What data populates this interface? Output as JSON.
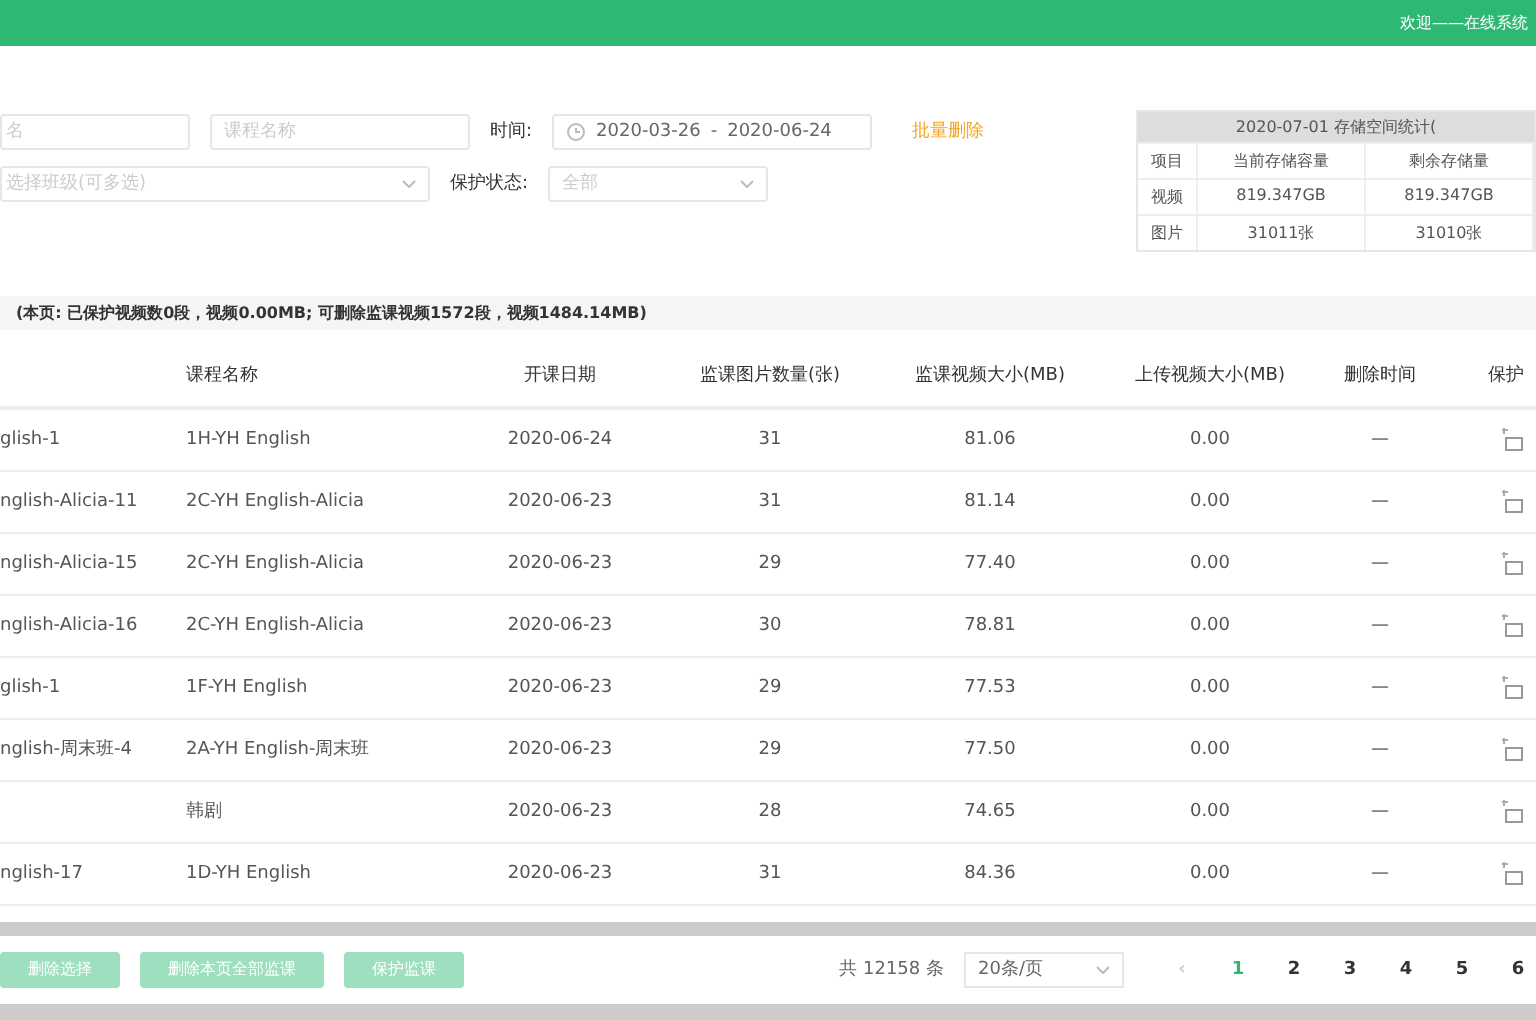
{
  "header": {
    "user_text": "欢迎——在线系统"
  },
  "filters": {
    "name_placeholder": "名",
    "course_placeholder": "课程名称",
    "time_label": "时间:",
    "date_start": "2020-03-26",
    "date_sep": "-",
    "date_end": "2020-06-24",
    "action_link": "批量删除",
    "class_placeholder": "选择班级(可多选)",
    "protect_label": "保护状态:",
    "protect_value": "全部"
  },
  "stats": {
    "title": "2020-07-01 存储空间统计(",
    "rows": [
      [
        "项目",
        "当前存储容量",
        "剩余存储量"
      ],
      [
        "视频",
        "819.347GB",
        "819.347GB"
      ],
      [
        "图片",
        "31011张",
        "31010张"
      ]
    ]
  },
  "summary": "(本页: 已保护视频数0段，视频0.00MB; 可删除监课视频1572段，视频1484.14MB)",
  "table": {
    "columns": [
      "",
      "课程名称",
      "开课日期",
      "监课图片数量(张)",
      "监课视频大小(MB)",
      "上传视频大小(MB)",
      "删除时间",
      "保护"
    ],
    "rows": [
      [
        "glish-1",
        "1H-YH English",
        "2020-06-24",
        "31",
        "81.06",
        "0.00",
        "—"
      ],
      [
        "nglish-Alicia-11",
        "2C-YH English-Alicia",
        "2020-06-23",
        "31",
        "81.14",
        "0.00",
        "—"
      ],
      [
        "nglish-Alicia-15",
        "2C-YH English-Alicia",
        "2020-06-23",
        "29",
        "77.40",
        "0.00",
        "—"
      ],
      [
        "nglish-Alicia-16",
        "2C-YH English-Alicia",
        "2020-06-23",
        "30",
        "78.81",
        "0.00",
        "—"
      ],
      [
        "glish-1",
        "1F-YH English",
        "2020-06-23",
        "29",
        "77.53",
        "0.00",
        "—"
      ],
      [
        "nglish-周末班-4",
        "2A-YH English-周末班",
        "2020-06-23",
        "29",
        "77.50",
        "0.00",
        "—"
      ],
      [
        "",
        "韩剧",
        "2020-06-23",
        "28",
        "74.65",
        "0.00",
        "—"
      ],
      [
        "nglish-17",
        "1D-YH English",
        "2020-06-23",
        "31",
        "84.36",
        "0.00",
        "—"
      ]
    ]
  },
  "buttons": [
    "删除选择",
    "删除本页全部监课",
    "保护监课"
  ],
  "pagination": {
    "total": "共 12158 条",
    "page_size": "20条/页",
    "prev": "‹",
    "pages": [
      {
        "label": "1",
        "selected": true
      },
      {
        "label": "2",
        "selected": false
      },
      {
        "label": "3",
        "selected": false
      },
      {
        "label": "4",
        "selected": false
      },
      {
        "label": "5",
        "selected": false
      },
      {
        "label": "6",
        "selected": false
      }
    ]
  }
}
